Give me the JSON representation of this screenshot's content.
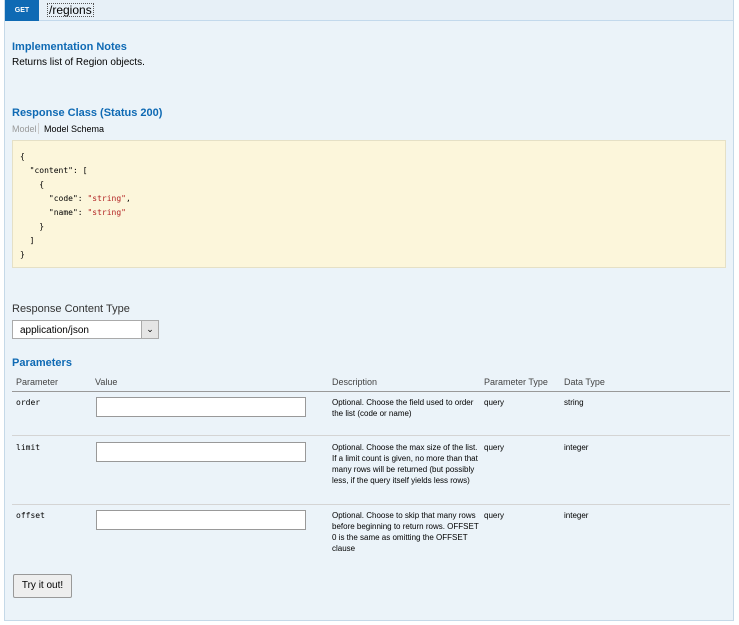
{
  "operation": {
    "method": "GET",
    "path": "/regions"
  },
  "implementation_notes": {
    "heading": "Implementation Notes",
    "text": "Returns list of Region objects."
  },
  "response_class": {
    "heading": "Response Class (Status 200)",
    "tab_model": "Model",
    "tab_schema": "Model Schema",
    "schema_lines": [
      "{",
      "  \"content\": [",
      "    {",
      "      \"code\": \"string\",",
      "      \"name\": \"string\"",
      "    }",
      "  ]",
      "}"
    ]
  },
  "response_content_type": {
    "label": "Response Content Type",
    "selected": "application/json"
  },
  "parameters": {
    "heading": "Parameters",
    "columns": [
      "Parameter",
      "Value",
      "Description",
      "Parameter Type",
      "Data Type"
    ],
    "rows": [
      {
        "name": "order",
        "value": "",
        "description": "Optional. Choose the field used to order the list (code or name)",
        "param_type": "query",
        "data_type": "string"
      },
      {
        "name": "limit",
        "value": "",
        "description": "Optional. Choose the max size of the list. If a limit count is given, no more than that many rows will be returned (but possibly less, if the query itself yields less rows)",
        "param_type": "query",
        "data_type": "integer"
      },
      {
        "name": "offset",
        "value": "",
        "description": "Optional. Choose to skip that many rows before beginning to return rows. OFFSET 0 is the same as omitting the OFFSET clause",
        "param_type": "query",
        "data_type": "integer"
      }
    ]
  },
  "try_button": "Try it out!",
  "colors": {
    "accent": "#0f6ab4",
    "panel_bg": "#ebf3f9",
    "schema_bg": "#fcf6db",
    "string_color": "#b22222"
  }
}
